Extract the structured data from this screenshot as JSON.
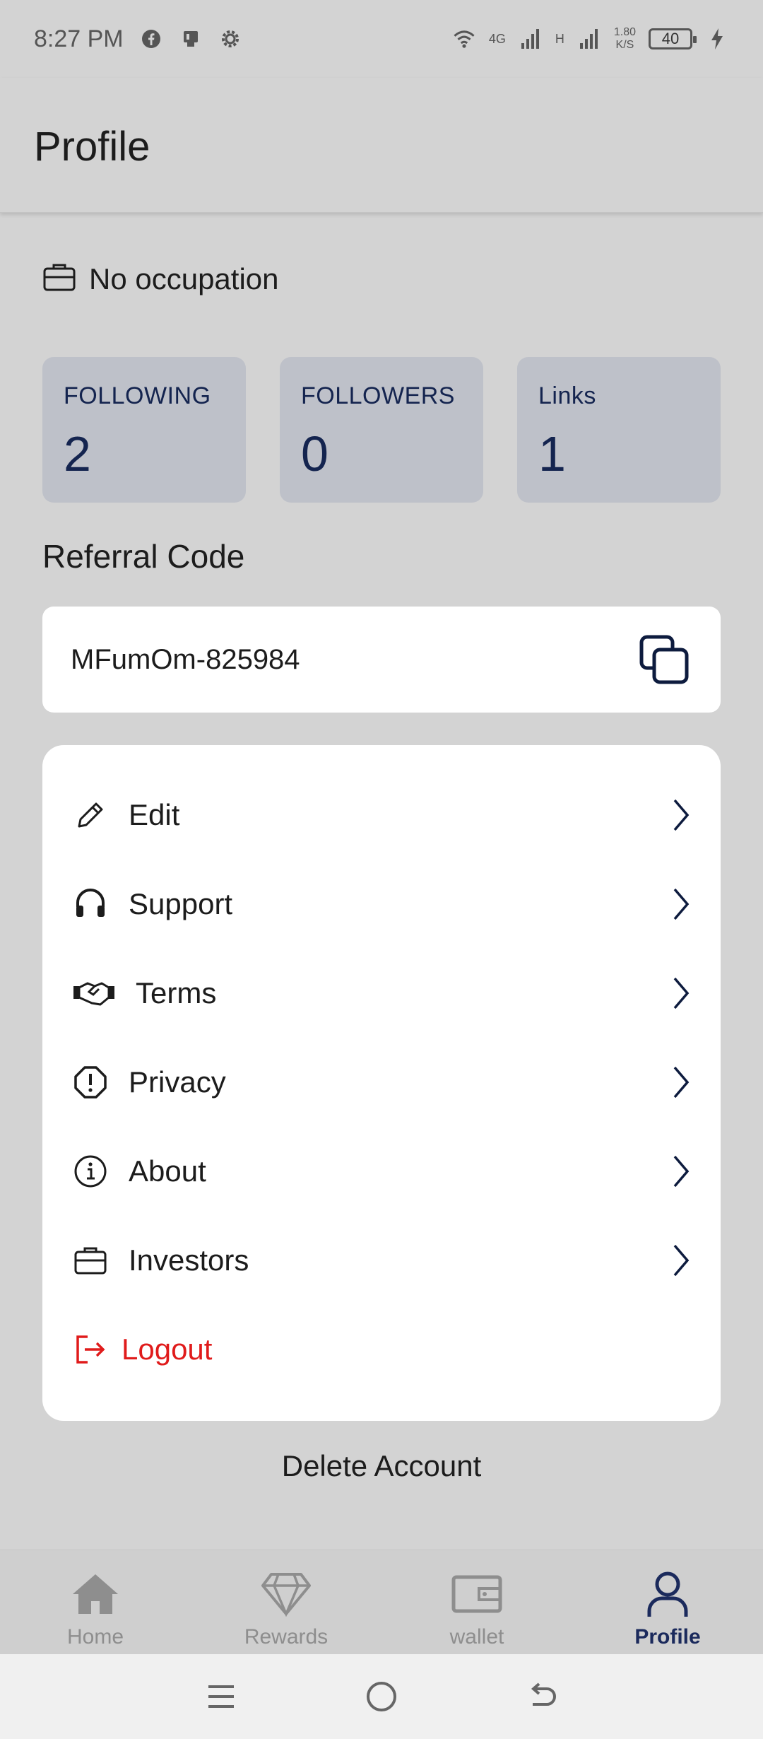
{
  "status_bar": {
    "time": "8:27 PM",
    "network_4g": "4G",
    "network_h": "H",
    "speed_value": "1.80",
    "speed_unit": "K/S",
    "battery": "40"
  },
  "header": {
    "title": "Profile"
  },
  "occupation": {
    "text": "No occupation",
    "icon": "briefcase-icon"
  },
  "stats": [
    {
      "label": "FOLLOWING",
      "value": "2"
    },
    {
      "label": "FOLLOWERS",
      "value": "0"
    },
    {
      "label": "Links",
      "value": "1"
    }
  ],
  "referral": {
    "heading": "Referral Code",
    "code": "MFumOm-825984",
    "icon": "copy-icon"
  },
  "menu": [
    {
      "label": "Edit",
      "icon": "pencil-icon"
    },
    {
      "label": "Support",
      "icon": "headset-icon"
    },
    {
      "label": "Terms",
      "icon": "handshake-icon"
    },
    {
      "label": "Privacy",
      "icon": "alert-octagon-icon"
    },
    {
      "label": "About",
      "icon": "info-icon"
    },
    {
      "label": "Investors",
      "icon": "briefcase-icon"
    },
    {
      "label": "Logout",
      "icon": "logout-icon",
      "color": "#e01b1b"
    }
  ],
  "delete_account": "Delete Account",
  "bottom_nav": [
    {
      "label": "Home",
      "icon": "home-icon"
    },
    {
      "label": "Rewards",
      "icon": "diamond-icon"
    },
    {
      "label": "wallet",
      "icon": "wallet-icon"
    },
    {
      "label": "Profile",
      "icon": "user-icon",
      "active": true
    }
  ],
  "colors": {
    "background": "#d3d3d3",
    "stat_card": "#bec1c9",
    "stat_text": "#14244f",
    "active_nav": "#1b2a5c",
    "logout": "#e01b1b"
  }
}
